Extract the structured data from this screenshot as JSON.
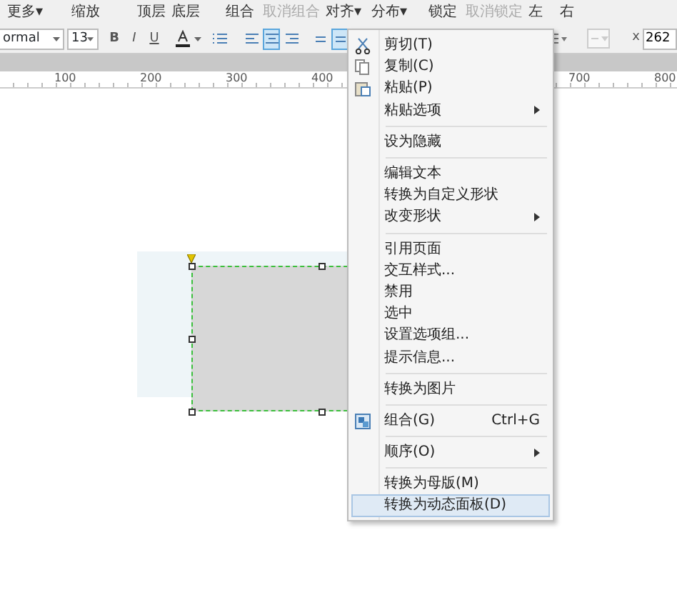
{
  "toolbar": {
    "labels": [
      {
        "text": "更多▾",
        "disabled": false
      },
      {
        "text": "缩放",
        "disabled": false
      },
      {
        "text": "顶层",
        "disabled": false
      },
      {
        "text": "底层",
        "disabled": false
      },
      {
        "text": "组合",
        "disabled": false
      },
      {
        "text": "取消组合",
        "disabled": true
      },
      {
        "text": "对齐▾",
        "disabled": false
      },
      {
        "text": "分布▾",
        "disabled": false
      },
      {
        "text": "锁定",
        "disabled": false
      },
      {
        "text": "取消锁定",
        "disabled": true
      },
      {
        "text": "左",
        "disabled": false
      },
      {
        "text": "右",
        "disabled": false
      }
    ]
  },
  "format_bar": {
    "style_select": "ormal",
    "font_size": "13",
    "text_buttons": [
      {
        "label": "B",
        "selected": false
      },
      {
        "label": "I",
        "selected": false
      },
      {
        "label": "U",
        "selected": false
      }
    ],
    "align_buttons": [
      {
        "selected": false
      },
      {
        "selected": true
      },
      {
        "selected": false
      }
    ],
    "valign_buttons": [
      {
        "selected": false
      },
      {
        "selected": true
      }
    ],
    "x_label": "x",
    "x_value": "262"
  },
  "ruler": {
    "labels": [
      "100",
      "200",
      "300",
      "400",
      "700",
      "800"
    ]
  },
  "context_menu": {
    "items": [
      {
        "kind": "command",
        "label": "剪切(T)",
        "selected": false
      },
      {
        "kind": "command",
        "label": "复制(C)",
        "selected": false
      },
      {
        "kind": "command",
        "label": "粘贴(P)",
        "selected": false
      },
      {
        "kind": "submenu",
        "label": "粘贴选项",
        "selected": false
      },
      {
        "kind": "separator"
      },
      {
        "kind": "command",
        "label": "设为隐藏",
        "selected": false
      },
      {
        "kind": "separator"
      },
      {
        "kind": "command",
        "label": "编辑文本",
        "selected": false
      },
      {
        "kind": "command",
        "label": "转换为自定义形状",
        "selected": false
      },
      {
        "kind": "submenu",
        "label": "改变形状",
        "selected": false
      },
      {
        "kind": "separator"
      },
      {
        "kind": "command",
        "label": "引用页面",
        "selected": false
      },
      {
        "kind": "command",
        "label": "交互样式...",
        "selected": false
      },
      {
        "kind": "command",
        "label": "禁用",
        "selected": false
      },
      {
        "kind": "command",
        "label": "选中",
        "selected": false
      },
      {
        "kind": "command",
        "label": "设置选项组...",
        "selected": false
      },
      {
        "kind": "command",
        "label": "提示信息...",
        "selected": false
      },
      {
        "kind": "separator"
      },
      {
        "kind": "command",
        "label": "转换为图片",
        "selected": false
      },
      {
        "kind": "separator"
      },
      {
        "kind": "command",
        "label": "组合(G)",
        "shortcut": "Ctrl+G",
        "selected": false
      },
      {
        "kind": "separator"
      },
      {
        "kind": "submenu",
        "label": "顺序(O)",
        "selected": false
      },
      {
        "kind": "separator"
      },
      {
        "kind": "command",
        "label": "转换为母版(M)",
        "selected": false
      },
      {
        "kind": "command",
        "label": "转换为动态面板(D)",
        "selected": true
      }
    ]
  }
}
